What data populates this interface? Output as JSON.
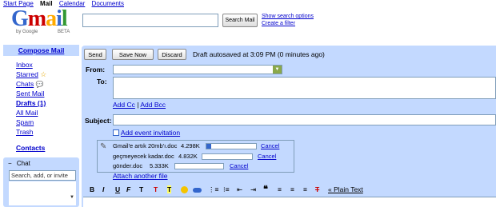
{
  "topnav": {
    "start_page": "Start Page",
    "mail": "Mail",
    "calendar": "Calendar",
    "documents": "Documents"
  },
  "logo": {
    "word": "Gmail",
    "by": "by Google",
    "beta": "BETA"
  },
  "search": {
    "value": "",
    "button": "Search Mail",
    "show_options": "Show search options",
    "create_filter": "Create a filter"
  },
  "sidebar": {
    "compose": "Compose Mail",
    "items": [
      {
        "label": "Inbox",
        "bold": false
      },
      {
        "label": "Starred",
        "bold": false
      },
      {
        "label": "Chats",
        "bold": false
      },
      {
        "label": "Sent Mail",
        "bold": false
      },
      {
        "label": "Drafts (1)",
        "bold": true
      },
      {
        "label": "All Mail",
        "bold": false
      },
      {
        "label": "Spam",
        "bold": false
      },
      {
        "label": "Trash",
        "bold": false
      }
    ],
    "contacts": "Contacts",
    "chat": {
      "header": "Chat",
      "collapse": "−",
      "placeholder": "Search, add, or invite",
      "scroll": "▼"
    }
  },
  "compose": {
    "send": "Send",
    "save_now": "Save Now",
    "discard": "Discard",
    "status": "Draft autosaved at 3:09 PM (0 minutes ago)",
    "from_label": "From:",
    "to_label": "To:",
    "add_cc": "Add Cc",
    "separator": "|",
    "add_bcc": "Add Bcc",
    "subject_label": "Subject:",
    "add_event": "Add event invitation",
    "attachments": [
      {
        "name": "Gmail'e artık 20mb'ı.doc",
        "size": "4.298K",
        "progress": 0.1,
        "cancel": "Cancel"
      },
      {
        "name": "geçmeyecek kadar.doc",
        "size": "4.832K",
        "progress": 0,
        "cancel": "Cancel"
      },
      {
        "name": "gönder.doc",
        "size": "5.333K",
        "progress": 0,
        "cancel": "Cancel"
      }
    ],
    "attach_another": "Attach another file",
    "plain_text": "« Plain Text"
  },
  "toolbar": {
    "icons": [
      "bold-icon",
      "italic-icon",
      "underline-icon",
      "font-icon",
      "font-size-icon",
      "text-color-icon",
      "highlight-icon",
      "emoticon-icon",
      "link-icon",
      "numbered-list-icon",
      "bullet-list-icon",
      "indent-less-icon",
      "indent-more-icon",
      "quote-icon",
      "align-left-icon",
      "align-center-icon",
      "align-right-icon",
      "remove-formatting-icon"
    ]
  }
}
